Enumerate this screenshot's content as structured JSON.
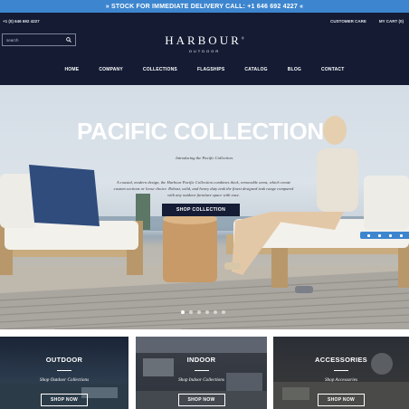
{
  "promo": {
    "text": "» STOCK FOR IMMEDIATE DELIVERY CALL: +1 646 692 4227 «"
  },
  "header": {
    "phone": "+1 (0) 646 692 4227",
    "customer_care": "CUSTOMER CARE",
    "my_cart": "MY CART (0)",
    "search_placeholder": "search",
    "logo_name": "HARBOUR",
    "logo_mark": "®",
    "logo_sub": "OUTDOOR"
  },
  "nav": [
    "HOME",
    "COMPANY",
    "COLLECTIONS",
    "FLAGSHIPS",
    "CATALOG",
    "BLOG",
    "CONTACT"
  ],
  "hero": {
    "title": "PACIFIC COLLECTION",
    "intro": "Introducing the Pacific Collection.",
    "description": "A coastal, modern design, the Harbour Pacific Collection combines thick, removable arms, which create custom sections or loose choice. Robust, solid, and heavy duty teak the finest designed teak range compared with any outdoor furniture space with ease.",
    "cta": "SHOP COLLECTION",
    "slides": 6,
    "active_slide": 1
  },
  "categories": [
    {
      "label": "OUTDOOR",
      "subtitle": "Shop Outdoor Collections",
      "button": "SHOP NOW"
    },
    {
      "label": "INDOOR",
      "subtitle": "Shop Indoor Collections",
      "button": "SHOP NOW"
    },
    {
      "label": "ACCESSORIES",
      "subtitle": "Shop Accessories",
      "button": "SHOP NOW"
    }
  ],
  "colors": {
    "navy": "#141b33",
    "accent_blue": "#3d86cf",
    "button_navy": "#151c35"
  },
  "icons": [
    "search-icon",
    "chat-icon",
    "phone-icon",
    "mail-icon"
  ]
}
